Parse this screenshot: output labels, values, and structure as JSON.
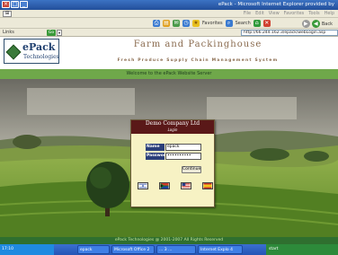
{
  "window": {
    "title": "ePack - Microsoft Internet Explorer provided by",
    "minimize_label": "_",
    "restore_label": "□",
    "close_label": "×"
  },
  "menubar": {
    "items": [
      "File",
      "Edit",
      "View",
      "Favorites",
      "Tools",
      "Help"
    ]
  },
  "toolbar": {
    "back_label": "Back",
    "search_label": "Search",
    "favorites_label": "Favorites"
  },
  "addressbar": {
    "links_label": "Links",
    "go_label": "Go",
    "url": "http://66.244.162.3/epack/webLogin.asp"
  },
  "header": {
    "logo_name": "ePack",
    "logo_sub": "Technologies",
    "site_title": "Farm and Packinghouse",
    "site_subtitle": "Fresh Produce Supply Chain Management System",
    "welcome": "Welcome to the ePack Website Server"
  },
  "login": {
    "company": "Demo Company Ltd",
    "subtitle": "Login",
    "name_label": "Name",
    "name_value": "epack",
    "password_label": "Password",
    "password_value": "••••••••••",
    "continue_label": "Continue",
    "flags": [
      "Israel",
      "South Africa",
      "USA",
      "Spain"
    ]
  },
  "footer": {
    "text": "ePack Technologies @ 2001-2007 All Rights Reserved"
  },
  "taskbar": {
    "clock": "17:10",
    "tasks": [
      "epack",
      "Microsoft Office 2",
      "... 3 ...",
      "Internet Explo 4"
    ],
    "start_label": "start"
  },
  "colors": {
    "header_green": "#6fa84a",
    "login_head": "#5a1818",
    "label_blue": "#2b3f7a",
    "footer_green": "#2f6f2f"
  }
}
